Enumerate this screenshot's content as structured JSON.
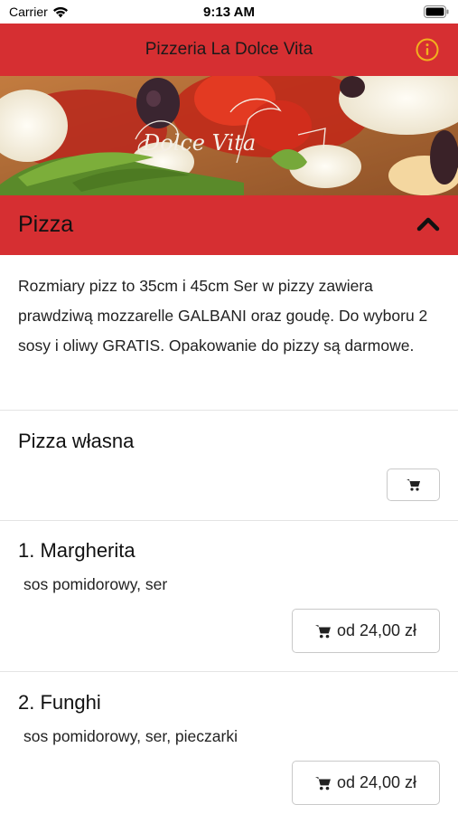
{
  "status_bar": {
    "carrier": "Carrier",
    "time": "9:13 AM"
  },
  "header": {
    "title": "Pizzeria La Dolce Vita",
    "info_icon": "info-icon"
  },
  "hero": {
    "logo_text": "Dolce Vita"
  },
  "colors": {
    "brand_red": "#d62f32",
    "info_accent": "#f2b01e"
  },
  "category": {
    "title": "Pizza",
    "expanded": true,
    "description": "Rozmiary pizz to 35cm i 45cm Ser w pizzy zawiera prawdziwą mozzarelle GALBANI oraz goudę. Do wyboru 2 sosy i oliwy GRATIS. Opakowanie do pizzy są darmowe."
  },
  "items": [
    {
      "name": "Pizza własna",
      "description": "",
      "price": ""
    },
    {
      "name": "1. Margherita",
      "description": "sos pomidorowy, ser",
      "price": "od 24,00 zł"
    },
    {
      "name": "2. Funghi",
      "description": "sos pomidorowy, ser, pieczarki",
      "price": "od 24,00 zł"
    }
  ]
}
